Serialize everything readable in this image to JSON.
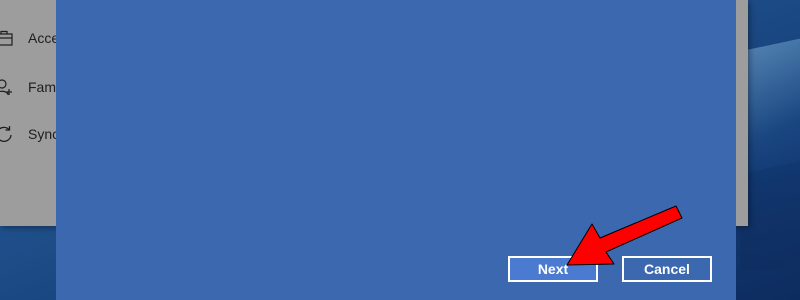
{
  "settings": {
    "items": [
      {
        "label": "Acce",
        "icon": "briefcase-icon"
      },
      {
        "label": "Fami",
        "icon": "person-add-icon"
      },
      {
        "label": "Sync",
        "icon": "sync-icon"
      }
    ]
  },
  "dialog": {
    "next_label": "Next",
    "cancel_label": "Cancel"
  },
  "annotation": {
    "arrow_color": "#ff0000",
    "arrow_icon": "red-arrow-icon"
  },
  "colors": {
    "dialog_bg": "#3c68b0",
    "next_bg": "#4a7bd1",
    "settings_bg": "#9d9d9d"
  }
}
